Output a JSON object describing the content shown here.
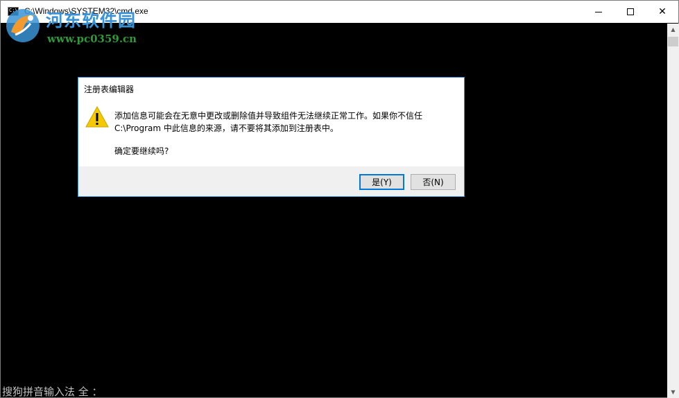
{
  "window": {
    "title": "C:\\Windows\\SYSTEM32\\cmd.exe",
    "minimize_glyph": "minimize-icon",
    "maximize_glyph": "maximize-icon",
    "close_glyph": "✕"
  },
  "watermark": {
    "name": "河东软件园",
    "url": "www.pc0359.cn"
  },
  "console": {
    "ime_status": "搜狗拼音输入法 全 ："
  },
  "dialog": {
    "title": "注册表编辑器",
    "message_line1": "添加信息可能会在无意中更改或删除值并导致组件无法继续正常工作。如果你不信任",
    "message_line2": "C:\\Program 中此信息的来源，请不要将其添加到注册表中。",
    "question": "确定要继续吗?",
    "yes_label": "是(Y)",
    "no_label": "否(N)",
    "icon": "warning-icon"
  },
  "colors": {
    "accent": "#0078d7",
    "dialog_border": "#3c8ed8",
    "warning": "#f5c900"
  }
}
